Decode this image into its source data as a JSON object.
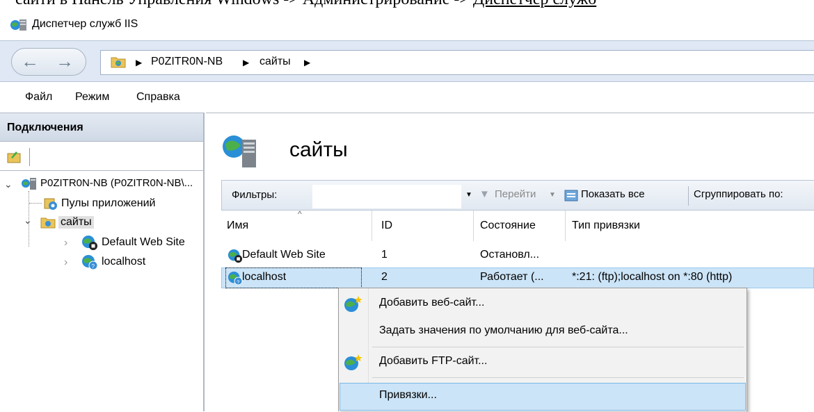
{
  "doc_line": {
    "prefix": "сайти в Панель Управления Windows -> Администрирование -> ",
    "link": "Диспетчер служб"
  },
  "window": {
    "title": "Диспетчер служб IIS"
  },
  "addressbar": {
    "back": "←",
    "forward": "→",
    "crumbs": [
      "P0ZITR0N-NB",
      "сайты"
    ]
  },
  "menu": [
    "Файл",
    "Режим",
    "Справка"
  ],
  "connections": {
    "title": "Подключения",
    "tree": {
      "server": "P0ZITR0N-NB (P0ZITR0N-NB\\...",
      "app_pools": "Пулы приложений",
      "sites": "сайты",
      "site1": "Default Web Site",
      "site2": "localhost"
    }
  },
  "main": {
    "title": "сайты",
    "filter": {
      "label": "Фильтры:",
      "go": "Перейти",
      "show_all": "Показать все",
      "group_by": "Сгруппировать по:"
    },
    "columns": [
      "Имя",
      "ID",
      "Состояние",
      "Тип привязки"
    ],
    "rows": [
      {
        "name": "Default Web Site",
        "id": "1",
        "state": "Остановл...",
        "binding": ""
      },
      {
        "name": "localhost",
        "id": "2",
        "state": "Работает (...",
        "binding": "*:21: (ftp);localhost on *:80 (http)"
      }
    ]
  },
  "context_menu": [
    "Добавить веб-сайт...",
    "Задать значения по умолчанию для веб-сайта...",
    "Добавить FTP-сайт...",
    "Привязки..."
  ],
  "colors": {
    "selection": "#cce4f7",
    "addressbar": "#dfe8f4",
    "header_gradient_top": "#e4eaf2"
  }
}
